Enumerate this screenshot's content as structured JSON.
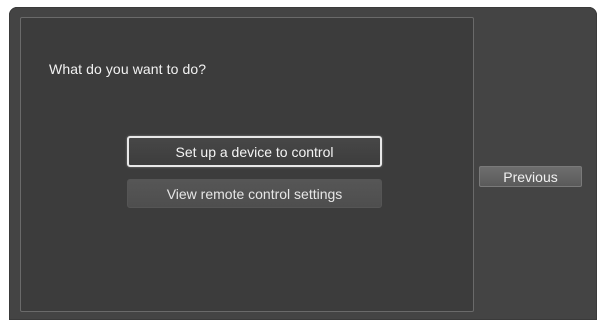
{
  "dialog": {
    "prompt": "What do you want to do?",
    "options": [
      {
        "label": "Set up a device to control",
        "focused": true
      },
      {
        "label": "View remote control settings",
        "focused": false
      }
    ],
    "previous_label": "Previous"
  }
}
